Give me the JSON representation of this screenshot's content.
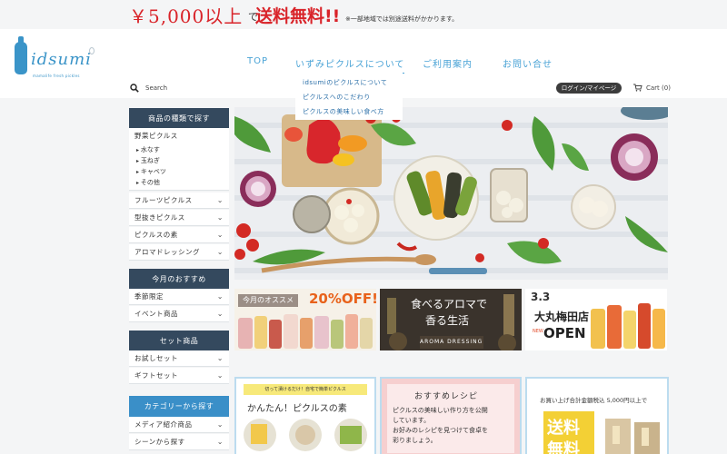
{
  "promo": {
    "price": "￥5,000以上",
    "de": "で",
    "free": "送料無料!!",
    "note": "※一部地域では別途送料がかかります。"
  },
  "header": {
    "logo_text": "idsumi",
    "logo_subtext": "mamalife fresh pickles",
    "nav": [
      "TOP",
      "いずみピクルスについて",
      "ご利用案内",
      "お問い合せ"
    ],
    "dropdown": [
      "idsumiのピクルスについて",
      "ピクルスへのこだわり",
      "ピクルスの美味しい食べ方"
    ],
    "search_placeholder": "Search",
    "login_label": "ログイン/マイページ",
    "cart_label": "Cart (0)"
  },
  "sidebar": {
    "section1_title": "商品の種類で探す",
    "vegetable": "野菜ピクルス",
    "vegetable_items": [
      "水なす",
      "玉ねぎ",
      "キャベツ",
      "その他"
    ],
    "items1": [
      "フルーツピクルス",
      "型抜きピクルス",
      "ピクルスの素",
      "アロマドレッシング"
    ],
    "section2_title": "今月のおすすめ",
    "items2": [
      "季節限定",
      "イベント商品"
    ],
    "section3_title": "セット商品",
    "items3": [
      "お試しセット",
      "ギフトセット"
    ],
    "section4_title": "カテゴリーから探す",
    "items4": [
      "メディア紹介商品",
      "シーンから探す"
    ]
  },
  "banners": {
    "b1_tag": "今月のオススメ",
    "b1_off": "20%OFF!",
    "b2_line1": "食べるアロマで",
    "b2_line2": "香る生活",
    "b2_sub": "AROMA DRESSING",
    "b3_date": "3.3",
    "b3_store": "大丸梅田店",
    "b3_open": "OPEN",
    "b3_new": "NEW"
  },
  "cards": {
    "c1_top": "切って漬けるだけ！自宅で簡単ピクルス",
    "c1_title": "かんたん！ピクルスの素",
    "c2_title": "おすすめレシピ",
    "c2_text": [
      "ピクルスの美味しい作り方を公開",
      "しています。",
      "お好みのレシピを見つけて食卓を",
      "彩りましょう。"
    ],
    "c3_top": "お買い上げ合計金額税込 5,000円以上で",
    "c3_big": "送料",
    "c3_big2": "無料"
  },
  "colors": {
    "accent_blue": "#4aa3d6",
    "sidebar_dark": "#34495e",
    "promo_red": "#d9242a"
  }
}
